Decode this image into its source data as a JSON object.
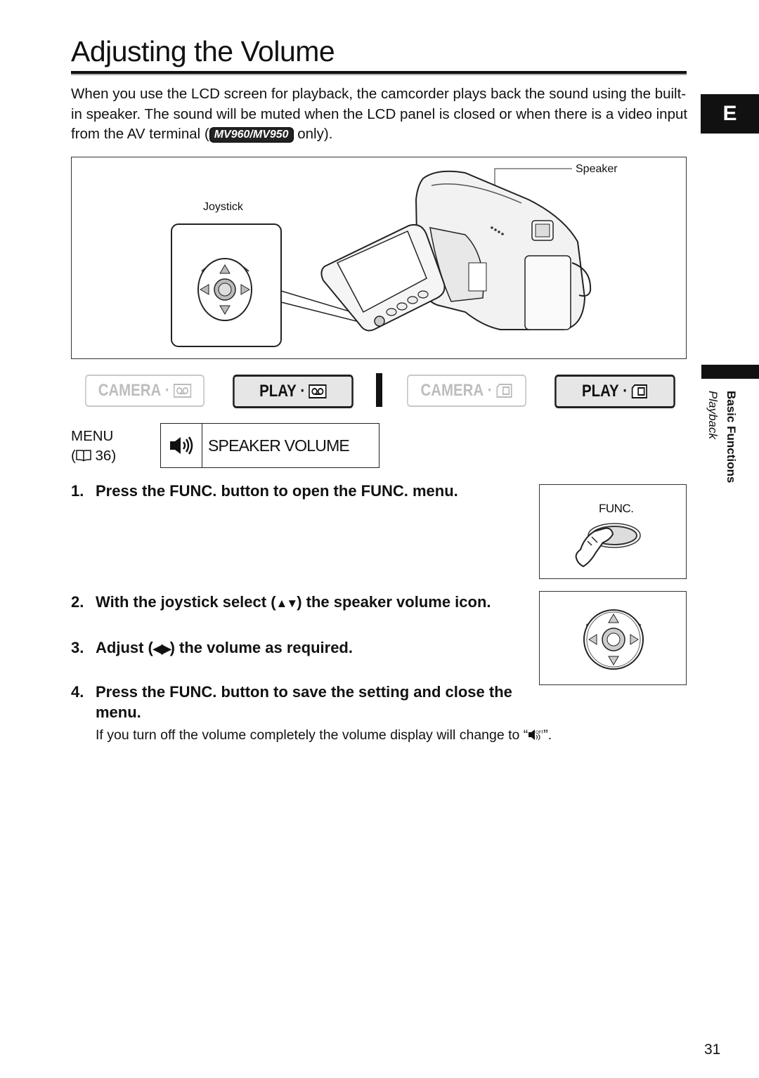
{
  "page": {
    "title": "Adjusting the Volume",
    "intro_part1": "When you use the LCD screen for playback, the camcorder plays back the sound using the built-in speaker. The sound will be muted when the LCD panel is closed or when there is a video input from the AV terminal (",
    "model_badge": "MV960/MV950",
    "intro_part2": " only).",
    "page_number": "31"
  },
  "side_tabs": {
    "language": "E",
    "section": "Basic Functions",
    "subsection": "Playback"
  },
  "figure": {
    "labels": {
      "speaker": "Speaker",
      "joystick": "Joystick"
    },
    "icons": [
      "camcorder-illustration",
      "joystick-closeup-icon"
    ]
  },
  "modes": [
    {
      "label": "CAMERA",
      "icon": "tape-icon",
      "active": false
    },
    {
      "label": "PLAY",
      "icon": "tape-icon",
      "active": true
    },
    {
      "label": "CAMERA",
      "icon": "card-icon",
      "active": false
    },
    {
      "label": "PLAY",
      "icon": "card-icon",
      "active": true
    }
  ],
  "menu": {
    "label": "MENU",
    "ref_prefix": "(",
    "ref_page": " 36)",
    "ref_icon": "book-icon",
    "item_icon": "speaker-icon",
    "item_label": "SPEAKER VOLUME"
  },
  "steps": [
    {
      "num": "1.",
      "text": "Press the FUNC. button to open the FUNC. menu."
    },
    {
      "num": "2.",
      "text_before": "With the joystick select (",
      "glyph": "▲▼",
      "text_after": ") the speaker volume icon."
    },
    {
      "num": "3.",
      "text_before": "Adjust (",
      "glyph": "◀▶",
      "text_after": ") the volume as required."
    },
    {
      "num": "4.",
      "text": "Press the FUNC. button to save the setting and close the menu."
    }
  ],
  "func_figure": {
    "label": "FUNC."
  },
  "note": {
    "text_before": "If you turn off the volume completely the volume display will change to “",
    "icon": "speaker-off-icon",
    "text_after": "”."
  }
}
